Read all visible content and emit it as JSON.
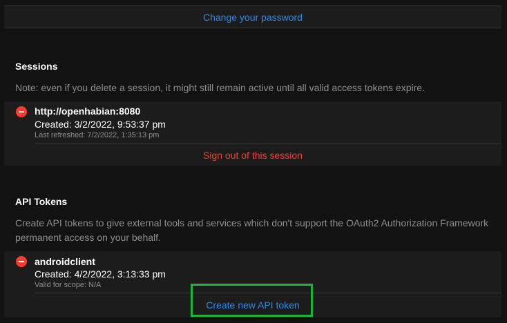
{
  "password": {
    "change_label": "Change your password"
  },
  "sessions": {
    "title": "Sessions",
    "note": "Note: even if you delete a session, it might still remain active until all valid access tokens expire.",
    "items": [
      {
        "name": "http://openhabian:8080",
        "created": "Created: 3/2/2022, 9:53:37 pm",
        "last_refreshed": "Last refreshed: 7/2/2022, 1:35:13 pm",
        "action_label": "Sign out of this session"
      }
    ]
  },
  "api_tokens": {
    "title": "API Tokens",
    "note": "Create API tokens to give external tools and services which don't support the OAuth2 Authorization Framework permanent access on your behalf.",
    "items": [
      {
        "name": "androidclient",
        "created": "Created: 4/2/2022, 3:13:33 pm",
        "scope": "Valid for scope: N/A"
      }
    ],
    "create_label": "Create new API token"
  },
  "colors": {
    "link_blue": "#2f8ae6",
    "danger_red": "#ff3b30",
    "highlight_green": "#22b33a"
  }
}
